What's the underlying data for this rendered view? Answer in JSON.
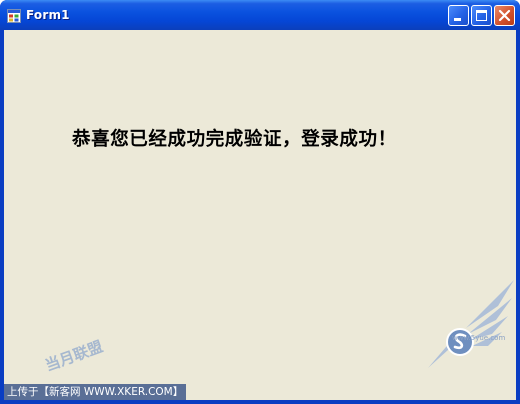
{
  "window": {
    "title": "Form1"
  },
  "content": {
    "message": "恭喜您已经成功完成验证，登录成功！"
  },
  "overlay": {
    "upload_label": "上传于【新客网 WWW.XKER.COM】",
    "watermark_text": "当月联盟",
    "watermark_url": "www.5yue.com"
  },
  "icons": {
    "app": "form-app-icon",
    "minimize": "minimize-icon",
    "maximize": "maximize-icon",
    "close": "close-icon"
  }
}
